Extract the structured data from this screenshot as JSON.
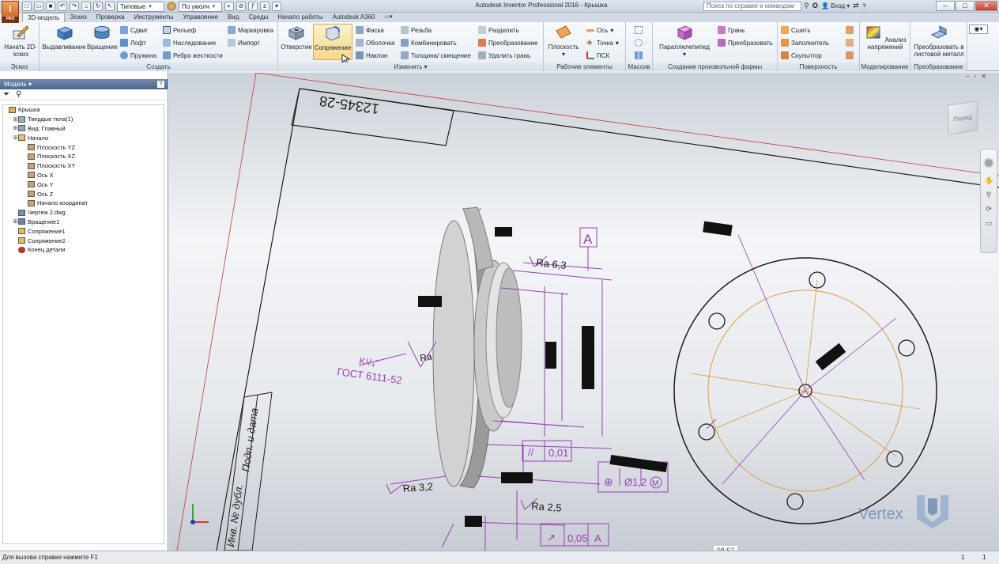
{
  "app": {
    "logo": "I",
    "logo_sub": "PRO"
  },
  "qat": {
    "style_select": "Типовые",
    "material_select": "По умолч"
  },
  "window": {
    "title": "Autodesk Inventor Professional 2016 - Крышка"
  },
  "search": {
    "placeholder": "Поиск по справке и командам"
  },
  "login": {
    "label": "Вход"
  },
  "tabs": [
    {
      "label": "3D-модель"
    },
    {
      "label": "Эскиз"
    },
    {
      "label": "Проверка"
    },
    {
      "label": "Инструменты"
    },
    {
      "label": "Управление"
    },
    {
      "label": "Вид"
    },
    {
      "label": "Среды"
    },
    {
      "label": "Начало работы"
    },
    {
      "label": "Autodesk A360"
    }
  ],
  "ribbon": {
    "sketch": {
      "label": "Эскиз",
      "start": "Начать 2D-эскиз"
    },
    "create": {
      "label": "Создать",
      "extrude": "Выдавливание",
      "revolve": "Вращение",
      "shift": "Сдвиг",
      "loft": "Лофт",
      "coil": "Пружина",
      "emboss": "Рельеф",
      "derive": "Наследование",
      "rib": "Ребро жесткости",
      "mark": "Маркировка",
      "import": "Импорт"
    },
    "modify": {
      "label": "Изменить",
      "hole": "Отверстие",
      "fillet": "Сопряжение",
      "chamfer": "Фаска",
      "shell": "Оболочка",
      "draft": "Наклон",
      "thread": "Резьба",
      "combine": "Комбинировать",
      "thicken": "Толщина/ смещение",
      "split": "Разделить",
      "direct": "Преобразование",
      "delete_face": "Удалить грань"
    },
    "work": {
      "label": "Рабочие элементы",
      "plane": "Плоскость",
      "axis": "Ось",
      "point": "Точка",
      "ucs": "ПСК"
    },
    "pattern": {
      "label": "Массив"
    },
    "freeform": {
      "label": "Создание произвольной формы",
      "box": "Параллелепипед",
      "face": "Грань",
      "convert": "Преобразовать"
    },
    "surface": {
      "label": "Поверхность",
      "stitch": "Сшить",
      "patch": "Заполнитель",
      "sculpt": "Скульптор"
    },
    "simulation": {
      "label": "Моделирование",
      "stress": "Анализ напряжений"
    },
    "convert": {
      "label": "Преобразование",
      "sheet": "Преобразовать в листовой металл"
    }
  },
  "browser": {
    "title": "Модель",
    "tree": [
      {
        "label": "Крышка",
        "indent": 0,
        "icon": "part"
      },
      {
        "label": "Твердые тела(1)",
        "indent": 1,
        "icon": "bodies"
      },
      {
        "label": "Вид: Главный",
        "indent": 1,
        "icon": "view"
      },
      {
        "label": "Начало",
        "indent": 1,
        "icon": "folder"
      },
      {
        "label": "Плоскость YZ",
        "indent": 2,
        "icon": "plane"
      },
      {
        "label": "Плоскость XZ",
        "indent": 2,
        "icon": "plane"
      },
      {
        "label": "Плоскость XY",
        "indent": 2,
        "icon": "plane"
      },
      {
        "label": "Ось X",
        "indent": 2,
        "icon": "axis"
      },
      {
        "label": "Ось Y",
        "indent": 2,
        "icon": "axis"
      },
      {
        "label": "Ось Z",
        "indent": 2,
        "icon": "axis"
      },
      {
        "label": "Начало координат",
        "indent": 2,
        "icon": "point"
      },
      {
        "label": "Чертеж 2.dwg",
        "indent": 1,
        "icon": "dwg"
      },
      {
        "label": "Вращение1",
        "indent": 1,
        "icon": "revolve"
      },
      {
        "label": "Сопряжение1",
        "indent": 1,
        "icon": "fillet"
      },
      {
        "label": "Сопряжение2",
        "indent": 1,
        "icon": "fillet"
      },
      {
        "label": "Конец детали",
        "indent": 1,
        "icon": "end"
      }
    ]
  },
  "drawing": {
    "part_number": "12345-28",
    "datum": "A",
    "ra1": "Ra 6,3",
    "ra2": "Ra 3,2",
    "ra3": "Ra 2,5",
    "ra4": "Ra",
    "tol1": "0,01",
    "tol2": "0,05",
    "tol2_datum": "A",
    "pos": "Ø1,2",
    "pos_mod": "M",
    "gost": "ГОСТ 6111-52",
    "k_label": "K¹/₄\"",
    "title_block1": "Подп. и дата",
    "title_block2": "Инв. № дубл."
  },
  "viewcube": {
    "face": "Перед"
  },
  "watermark": "Vertex",
  "status": {
    "help": "Для вызова справки нажмите F1",
    "count1": "1",
    "count2": "1"
  },
  "video_time": "08:52",
  "colors": {
    "dimension": "#9b3db8",
    "pcd": "#e09a3a",
    "accent": "#4a7ebb"
  }
}
